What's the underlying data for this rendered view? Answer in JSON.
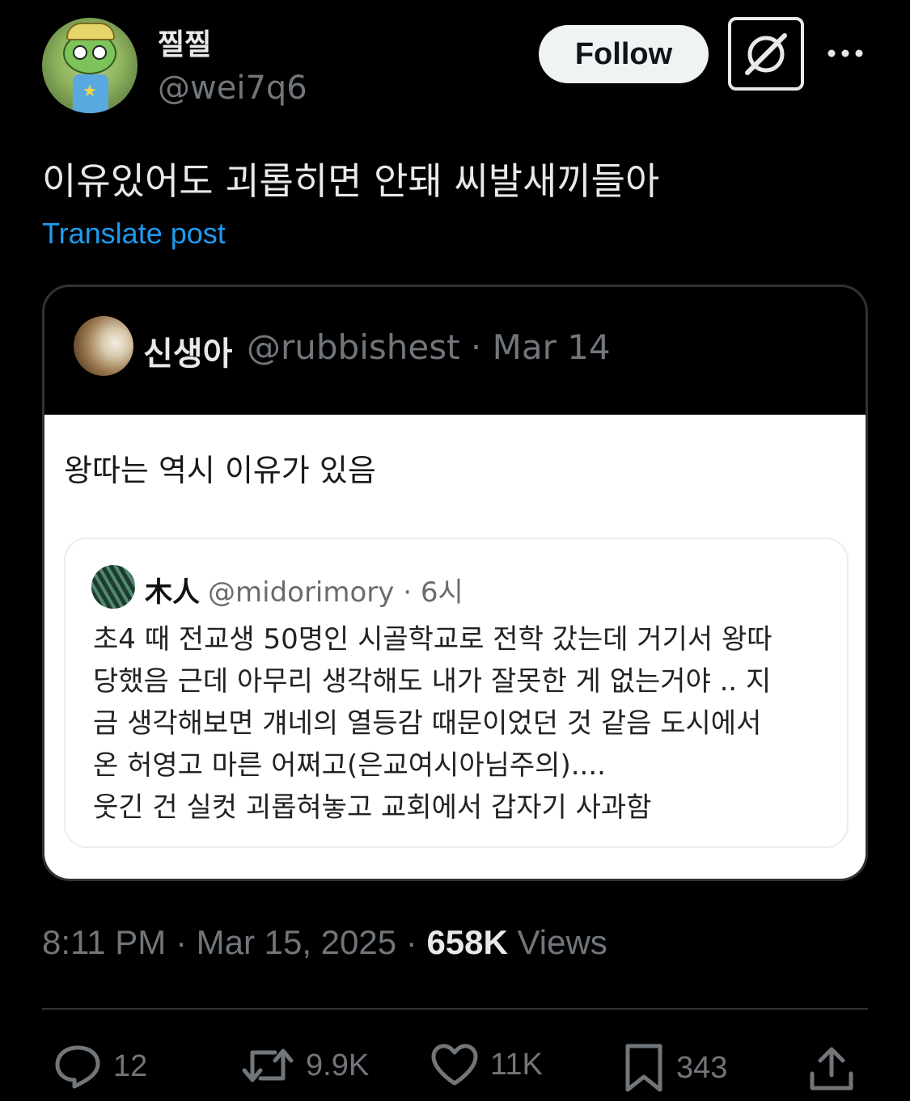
{
  "author": {
    "display_name": "찔찔",
    "handle": "@wei7q6"
  },
  "header": {
    "follow_label": "Follow",
    "grok_icon": "grok-icon",
    "more_icon": "more-dots-icon"
  },
  "tweet": {
    "text": "이유있어도 괴롭히면 안돼 씨발새끼들아",
    "translate_label": "Translate post"
  },
  "quote": {
    "name": "신생아",
    "meta": "@rubbishest · Mar 14",
    "image": {
      "text": "왕따는 역시 이유가 있음",
      "inner": {
        "name": "木人",
        "meta": "@midorimory · 6시",
        "lines": [
          "초4 때 전교생 50명인 시골학교로 전학 갔는데 거기서 왕따",
          "당했음 근데 아무리 생각해도 내가 잘못한 게 없는거야 .. 지",
          "금 생각해보면 걔네의 열등감 때문이었던 것 같음 도시에서",
          "온 허영고 마른 어쩌고(은교여시아님주의)....",
          "웃긴 건 실컷 괴롭혀놓고 교회에서 갑자기 사과함"
        ]
      }
    }
  },
  "meta": {
    "time_date": "8:11 PM · Mar 15, 2025 · ",
    "views_count": "658K",
    "views_label": " Views"
  },
  "actions": {
    "reply_count": "12",
    "repost_count": "9.9K",
    "like_count": "11K",
    "bookmark_count": "343"
  }
}
